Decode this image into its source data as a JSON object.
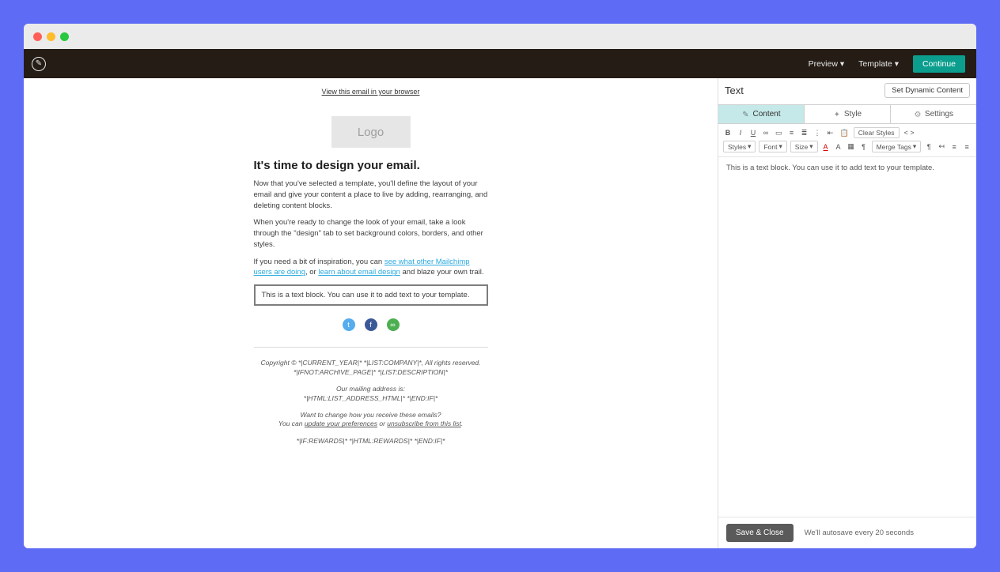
{
  "topbar": {
    "preview": "Preview",
    "template": "Template",
    "continue": "Continue"
  },
  "canvas": {
    "view_in_browser": "View this email in your browser",
    "logo_placeholder": "Logo",
    "headline": "It's time to design your email.",
    "p1": "Now that you've selected a template, you'll define the layout of your email and give your content a place to live by adding, rearranging, and deleting content blocks.",
    "p2": "When you're ready to change the look of your email, take a look through the \"design\" tab to set background colors, borders, and other styles.",
    "p3_pre": "If you need a bit of inspiration, you can ",
    "p3_link1": "see what other Mailchimp users are doing",
    "p3_mid": ", or ",
    "p3_link2": "learn about email design",
    "p3_post": " and blaze your own trail.",
    "text_block": "This is a text block. You can use it to add text to your template.",
    "footer_copy": "Copyright © *|CURRENT_YEAR|* *|LIST:COMPANY|*, All rights reserved.",
    "footer_archive": "*|IFNOT:ARCHIVE_PAGE|* *|LIST:DESCRIPTION|*",
    "footer_addr_label": "Our mailing address is:",
    "footer_addr_val": "*|HTML:LIST_ADDRESS_HTML|* *|END:IF|*",
    "footer_want": "Want to change how you receive these emails?",
    "footer_can": "You can ",
    "footer_upd": "update your preferences",
    "footer_or": " or ",
    "footer_unsub": "unsubscribe from this list",
    "footer_period": ".",
    "footer_rewards": "*|IF:REWARDS|* *|HTML:REWARDS|* *|END:IF|*"
  },
  "panel": {
    "title": "Text",
    "set_dynamic": "Set Dynamic Content",
    "tabs": {
      "content": "Content",
      "style": "Style",
      "settings": "Settings"
    },
    "toolbar_row1": {
      "bold": "B",
      "italic": "I",
      "underline": "U",
      "link": "∞",
      "image": "▭",
      "align": "≡",
      "list_ol": "≣",
      "list_ul": "⋮",
      "indent": "⇤",
      "paste": "📋",
      "clear_styles": "Clear Styles",
      "code": "< >"
    },
    "toolbar_row2": {
      "styles": "Styles",
      "font": "Font",
      "size": "Size",
      "fontcolor": "A",
      "back": "A",
      "table": "▦",
      "dir": "¶",
      "merge": "Merge Tags",
      "pil": "¶",
      "out": "↤",
      "al": "≡",
      "ac": "≡",
      "ar": "≡",
      "aj": "≡",
      "more": "▾"
    },
    "editor_content": "This is a text block. You can use it to add text to your template.",
    "save_close": "Save & Close",
    "autosave": "We'll autosave every 20 seconds"
  }
}
